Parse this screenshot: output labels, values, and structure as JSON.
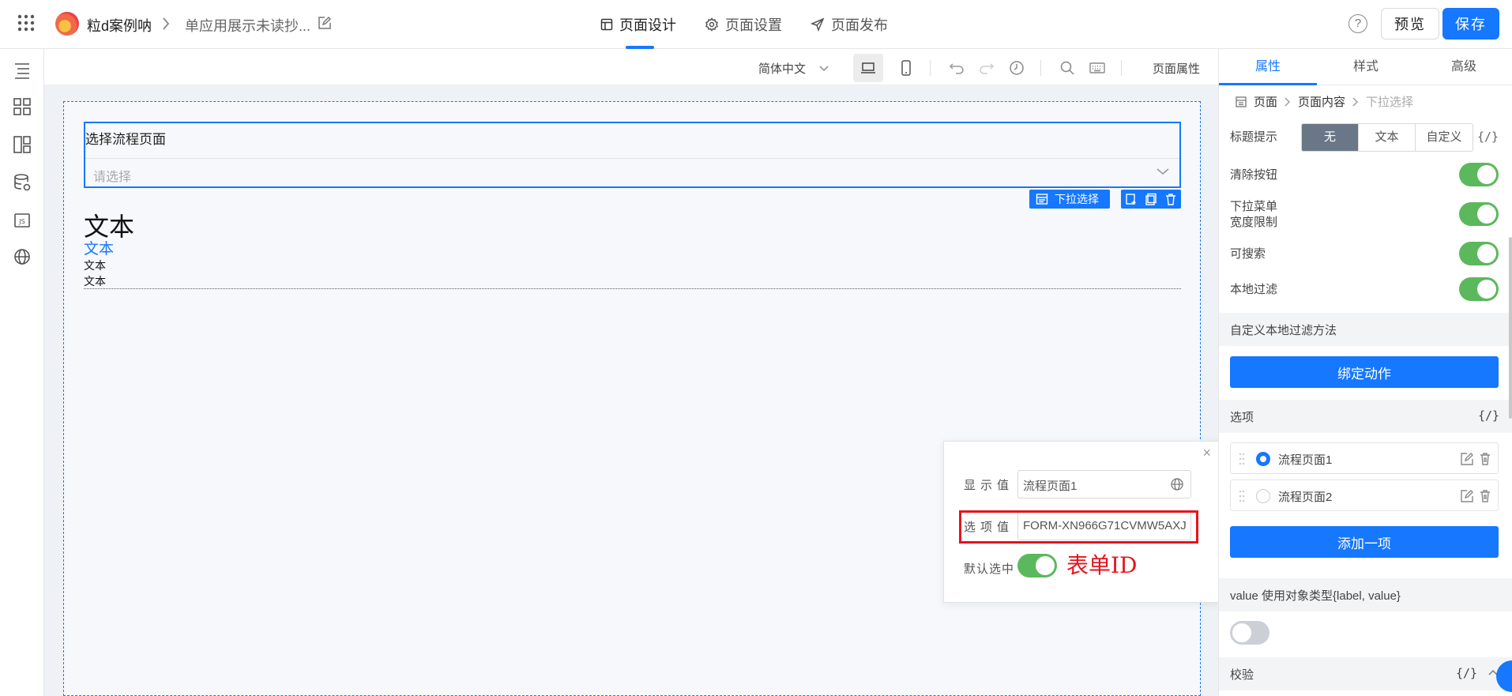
{
  "topbar": {
    "app_name": "粒d案例呐",
    "breadcrumb_page": "单应用展示未读抄...",
    "tabs": [
      {
        "label": "页面设计",
        "icon": "layout-icon",
        "active": true
      },
      {
        "label": "页面设置",
        "icon": "gear-icon",
        "active": false
      },
      {
        "label": "页面发布",
        "icon": "send-icon",
        "active": false
      }
    ],
    "help_glyph": "?",
    "preview_label": "预览",
    "save_label": "保存"
  },
  "canvas_toolbar": {
    "language": "简体中文",
    "page_props_label": "页面属性"
  },
  "canvas": {
    "select_title": "选择流程页面",
    "select_placeholder": "请选择",
    "component_tag": "下拉选择",
    "text_big": "文本",
    "text_link": "文本",
    "text_small_1": "文本",
    "text_small_2": "文本"
  },
  "popover": {
    "close_glyph": "×",
    "display_label": "显示值",
    "display_value": "流程页面1",
    "option_label": "选项值",
    "option_value": "FORM-XN966G71CVMW5AXJ",
    "default_label": "默认选中",
    "default_checked": true,
    "annotation": "表单ID",
    "annotation_color": "#e5141c"
  },
  "right_panel": {
    "tabs": [
      {
        "label": "属性",
        "active": true
      },
      {
        "label": "样式",
        "active": false
      },
      {
        "label": "高级",
        "active": false
      }
    ],
    "breadcrumb": [
      "页面",
      "页面内容",
      "下拉选择"
    ],
    "title_hint_label": "标题提示",
    "title_hint_options": [
      "无",
      "文本",
      "自定义"
    ],
    "title_hint_selected": "无",
    "fx_glyph": "{/}",
    "clear_button_label": "清除按钮",
    "dropdown_width_label_1": "下拉菜单",
    "dropdown_width_label_2": "宽度限制",
    "searchable_label": "可搜索",
    "local_filter_label": "本地过滤",
    "custom_filter_section": "自定义本地过滤方法",
    "bind_action_label": "绑定动作",
    "options_section": "选项",
    "options": [
      {
        "label": "流程页面1",
        "selected": true
      },
      {
        "label": "流程页面2",
        "selected": false
      }
    ],
    "add_option_label": "添加一项",
    "value_object_section": "value 使用对象类型{label, value}",
    "value_object_enabled": false,
    "validation_section": "校验"
  },
  "colors": {
    "primary": "#1677ff",
    "toggle_on": "#5cb85c",
    "toggle_off": "#ccd0d6",
    "segment_selected": "#6a7786"
  }
}
